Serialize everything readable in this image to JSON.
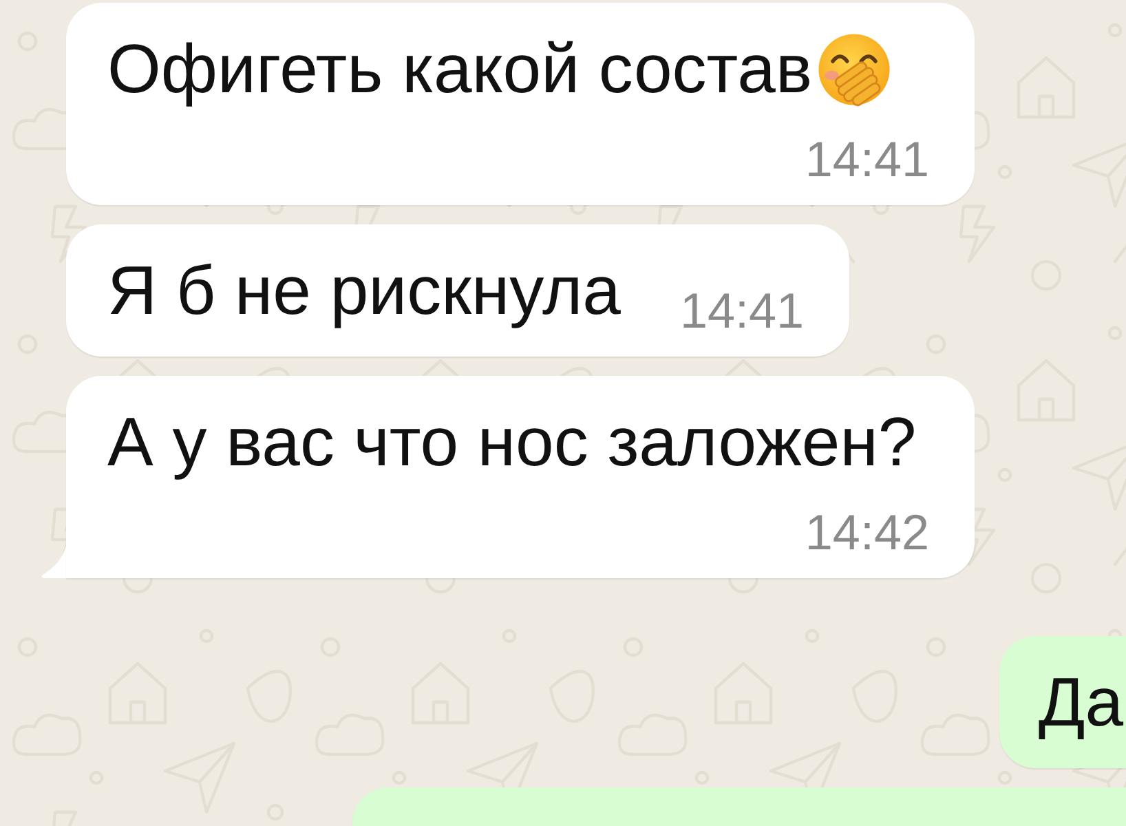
{
  "messages": [
    {
      "kind": "incoming",
      "text": "Офигеть какой состав",
      "emoji": true,
      "time": "14:41",
      "tail": false
    },
    {
      "kind": "incoming",
      "text": "Я б не рискнула",
      "emoji": false,
      "time": "14:41",
      "tail": false
    },
    {
      "kind": "incoming",
      "text": "А у вас что нос заложен?",
      "emoji": false,
      "time": "14:42",
      "tail": true
    },
    {
      "kind": "outgoing",
      "text": "Да",
      "emoji": false,
      "tail": false
    },
    {
      "kind": "outgoing",
      "emoji": false,
      "tail": false
    }
  ]
}
